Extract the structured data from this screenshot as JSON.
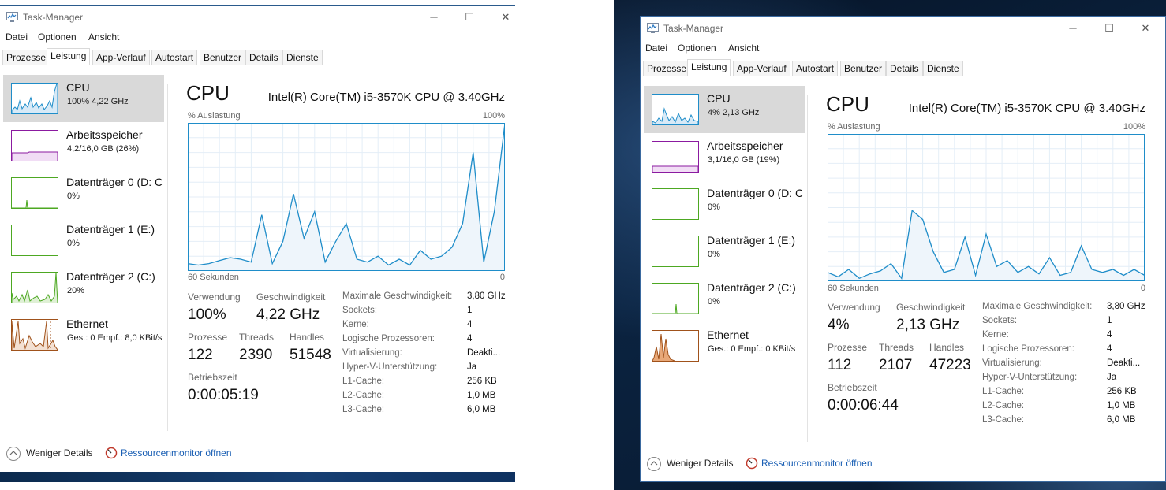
{
  "windows": [
    {
      "title": "Task-Manager",
      "menu": [
        "Datei",
        "Optionen",
        "Ansicht"
      ],
      "tabs": [
        "Prozesse",
        "Leistung",
        "App-Verlauf",
        "Autostart",
        "Benutzer",
        "Details",
        "Dienste"
      ],
      "active_tab": "Leistung",
      "sidebar": [
        {
          "name": "CPU",
          "value": "100% 4,22 GHz",
          "selected": true
        },
        {
          "name": "Arbeitsspeicher",
          "value": "4,2/16,0 GB (26%)"
        },
        {
          "name": "Datenträger 0 (D: C",
          "value": "0%"
        },
        {
          "name": "Datenträger 1 (E:)",
          "value": "0%"
        },
        {
          "name": "Datenträger 2 (C:)",
          "value": "20%"
        },
        {
          "name": "Ethernet",
          "value": "Ges.: 0 Empf.: 8,0 KBit/s"
        }
      ],
      "main": {
        "title": "CPU",
        "cpu_model": "Intel(R) Core(TM) i5-3570K CPU @ 3.40GHz",
        "y_label": "% Auslastung",
        "y_max_label": "100%",
        "x_left_label": "60 Sekunden",
        "x_right_label": "0"
      },
      "stats": {
        "usage_label": "Verwendung",
        "usage": "100%",
        "speed_label": "Geschwindigkeit",
        "speed": "4,22 GHz",
        "processes_label": "Prozesse",
        "processes": "122",
        "threads_label": "Threads",
        "threads": "2390",
        "handles_label": "Handles",
        "handles": "51548",
        "uptime_label": "Betriebszeit",
        "uptime": "0:00:05:19"
      },
      "specs": [
        {
          "k": "Maximale Geschwindigkeit:",
          "v": "3,80 GHz"
        },
        {
          "k": "Sockets:",
          "v": "1"
        },
        {
          "k": "Kerne:",
          "v": "4"
        },
        {
          "k": "Logische Prozessoren:",
          "v": "4"
        },
        {
          "k": "Virtualisierung:",
          "v": "Deakti..."
        },
        {
          "k": "Hyper-V-Unterstützung:",
          "v": "Ja"
        },
        {
          "k": "L1-Cache:",
          "v": "256 KB"
        },
        {
          "k": "L2-Cache:",
          "v": "1,0 MB"
        },
        {
          "k": "L3-Cache:",
          "v": "6,0 MB"
        }
      ],
      "footer": {
        "fewer_details": "Weniger Details",
        "resource_monitor": "Ressourcenmonitor öffnen"
      },
      "chart_data": {
        "type": "line",
        "title": "CPU",
        "ylabel": "% Auslastung",
        "xlabel": "60 Sekunden",
        "ylim": [
          0,
          100
        ],
        "x_range_seconds": [
          60,
          0
        ],
        "x": [
          60,
          58,
          56,
          54,
          52,
          50,
          48,
          46,
          44,
          42,
          40,
          38,
          36,
          34,
          32,
          30,
          28,
          26,
          24,
          22,
          20,
          18,
          16,
          14,
          12,
          10,
          8,
          6,
          4,
          2,
          0
        ],
        "values": [
          5,
          4,
          5,
          7,
          9,
          8,
          6,
          38,
          5,
          20,
          52,
          22,
          40,
          6,
          20,
          32,
          8,
          6,
          10,
          4,
          8,
          4,
          14,
          8,
          10,
          16,
          32,
          80,
          6,
          40,
          100
        ],
        "grid": true
      }
    },
    {
      "title": "Task-Manager",
      "menu": [
        "Datei",
        "Optionen",
        "Ansicht"
      ],
      "tabs": [
        "Prozesse",
        "Leistung",
        "App-Verlauf",
        "Autostart",
        "Benutzer",
        "Details",
        "Dienste"
      ],
      "active_tab": "Leistung",
      "sidebar": [
        {
          "name": "CPU",
          "value": "4% 2,13 GHz",
          "selected": true
        },
        {
          "name": "Arbeitsspeicher",
          "value": "3,1/16,0 GB (19%)"
        },
        {
          "name": "Datenträger 0 (D: C",
          "value": "0%"
        },
        {
          "name": "Datenträger 1 (E:)",
          "value": "0%"
        },
        {
          "name": "Datenträger 2 (C:)",
          "value": "0%"
        },
        {
          "name": "Ethernet",
          "value": "Ges.: 0 Empf.: 0 KBit/s"
        }
      ],
      "main": {
        "title": "CPU",
        "cpu_model": "Intel(R) Core(TM) i5-3570K CPU @ 3.40GHz",
        "y_label": "% Auslastung",
        "y_max_label": "100%",
        "x_left_label": "60 Sekunden",
        "x_right_label": "0"
      },
      "stats": {
        "usage_label": "Verwendung",
        "usage": "4%",
        "speed_label": "Geschwindigkeit",
        "speed": "2,13 GHz",
        "processes_label": "Prozesse",
        "processes": "112",
        "threads_label": "Threads",
        "threads": "2107",
        "handles_label": "Handles",
        "handles": "47223",
        "uptime_label": "Betriebszeit",
        "uptime": "0:00:06:44"
      },
      "specs": [
        {
          "k": "Maximale Geschwindigkeit:",
          "v": "3,80 GHz"
        },
        {
          "k": "Sockets:",
          "v": "1"
        },
        {
          "k": "Kerne:",
          "v": "4"
        },
        {
          "k": "Logische Prozessoren:",
          "v": "4"
        },
        {
          "k": "Virtualisierung:",
          "v": "Deakti..."
        },
        {
          "k": "Hyper-V-Unterstützung:",
          "v": "Ja"
        },
        {
          "k": "L1-Cache:",
          "v": "256 KB"
        },
        {
          "k": "L2-Cache:",
          "v": "1,0 MB"
        },
        {
          "k": "L3-Cache:",
          "v": "6,0 MB"
        }
      ],
      "footer": {
        "fewer_details": "Weniger Details",
        "resource_monitor": "Ressourcenmonitor öffnen"
      },
      "chart_data": {
        "type": "line",
        "title": "CPU",
        "ylabel": "% Auslastung",
        "xlabel": "60 Sekunden",
        "ylim": [
          0,
          100
        ],
        "x_range_seconds": [
          60,
          0
        ],
        "x": [
          60,
          58,
          56,
          54,
          52,
          50,
          48,
          46,
          44,
          42,
          40,
          38,
          36,
          34,
          32,
          30,
          28,
          26,
          24,
          22,
          20,
          18,
          16,
          14,
          12,
          10,
          8,
          6,
          4,
          2,
          0
        ],
        "values": [
          6,
          3,
          8,
          2,
          5,
          7,
          12,
          2,
          48,
          42,
          20,
          6,
          8,
          30,
          4,
          32,
          10,
          14,
          6,
          10,
          5,
          16,
          4,
          6,
          24,
          8,
          6,
          8,
          4,
          8,
          4
        ],
        "grid": true
      }
    }
  ],
  "colors": {
    "cpu_line": "#1f8dc9",
    "cpu_fill": "#eef5fb",
    "memory": "#8b1aa0",
    "disk": "#4da822",
    "ethernet": "#a0521b",
    "selected_bg": "#d9d9d9",
    "link": "#1a5fb4"
  }
}
